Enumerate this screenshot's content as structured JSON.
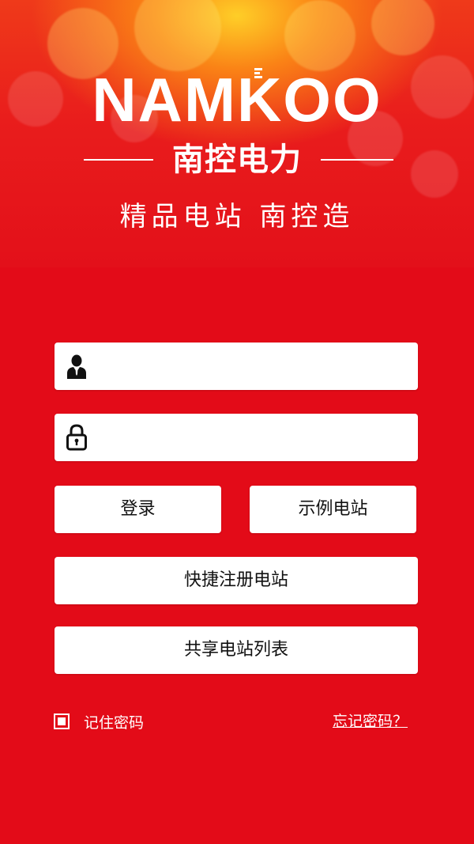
{
  "header": {
    "logo_text": "NAMKOO",
    "brand_cn": "南控电力",
    "slogan": "精品电站 南控造"
  },
  "form": {
    "username": {
      "value": "",
      "placeholder": "",
      "icon": "user-icon"
    },
    "password": {
      "value": "",
      "placeholder": "",
      "icon": "lock-icon"
    },
    "login_label": "登录",
    "demo_label": "示例电站",
    "register_label": "快捷注册电站",
    "shared_label": "共享电站列表",
    "remember_label": "记住密码",
    "forgot_label": "忘记密码？"
  },
  "colors": {
    "background": "#e30b18",
    "button_bg": "#ffffff",
    "text_white": "#ffffff"
  }
}
